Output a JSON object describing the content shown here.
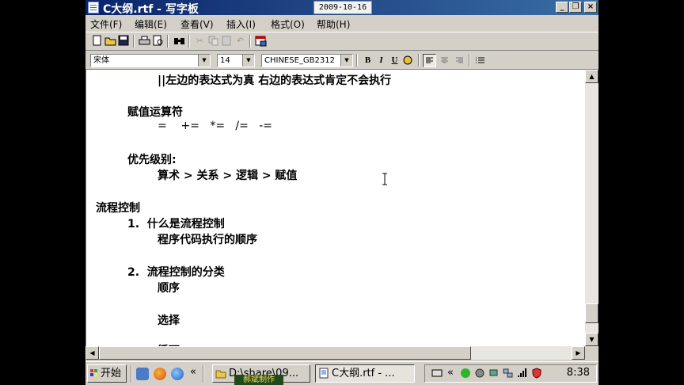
{
  "window": {
    "title": "C大纲.rtf - 写字板",
    "date_overlay": "2009-10-16",
    "caption_buttons": {
      "minimize": "_",
      "restore": "❐",
      "close": "×"
    }
  },
  "menu": [
    "文件(F)",
    "编辑(E)",
    "查看(V)",
    "插入(I)",
    "格式(O)",
    "帮助(H)"
  ],
  "format": {
    "font": "宋体",
    "size": "14",
    "script": "CHINESE_GB2312",
    "bold": "B",
    "italic": "I",
    "underline": "U"
  },
  "document": {
    "lines": [
      "||左边的表达式为真 右边的表达式肯定不会执行",
      "赋值运算符",
      "=    +=   *=   /=   -=",
      "优先级别:",
      "算术 > 关系 > 逻辑 > 赋值",
      "流程控制",
      "1.  什么是流程控制",
      "程序代码执行的顺序",
      "2.  流程控制的分类",
      "顺序",
      "选择",
      "循环"
    ]
  },
  "taskbar": {
    "start_label": "开始",
    "tasks": [
      "D:\\share\\09...",
      "C大纲.rtf - ..."
    ],
    "watermark": "郝斌制作",
    "clock": "8:38",
    "overflow": "«"
  }
}
